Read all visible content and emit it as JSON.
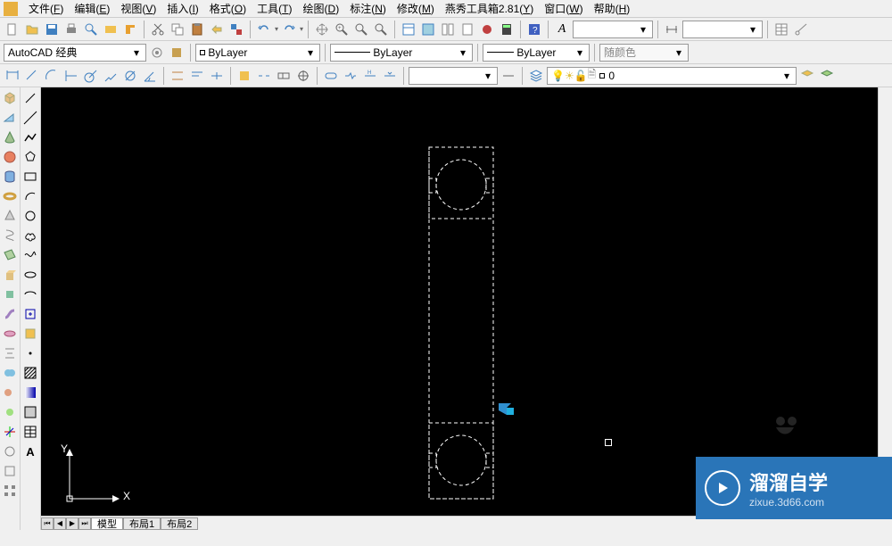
{
  "menubar": {
    "items": [
      {
        "label": "文件",
        "key": "F"
      },
      {
        "label": "编辑",
        "key": "E"
      },
      {
        "label": "视图",
        "key": "V"
      },
      {
        "label": "插入",
        "key": "I"
      },
      {
        "label": "格式",
        "key": "O"
      },
      {
        "label": "工具",
        "key": "T"
      },
      {
        "label": "绘图",
        "key": "D"
      },
      {
        "label": "标注",
        "key": "N"
      },
      {
        "label": "修改",
        "key": "M"
      },
      {
        "label": "燕秀工具箱2.81",
        "key": "Y"
      },
      {
        "label": "窗口",
        "key": "W"
      },
      {
        "label": "帮助",
        "key": "H"
      }
    ]
  },
  "workspace_combo": "AutoCAD 经典",
  "linetype_combo": "ByLayer",
  "lineweight_combo": "ByLayer",
  "plot_combo": "随颜色",
  "layer_color": "ByLayer",
  "layer_combo": "0",
  "text_style": "A",
  "ucs": {
    "x": "X",
    "y": "Y"
  },
  "tabs": {
    "model": "模型",
    "layout1": "布局1",
    "layout2": "布局2"
  },
  "watermark": {
    "title": "溜溜自学",
    "sub": "zixue.3d66.com"
  }
}
